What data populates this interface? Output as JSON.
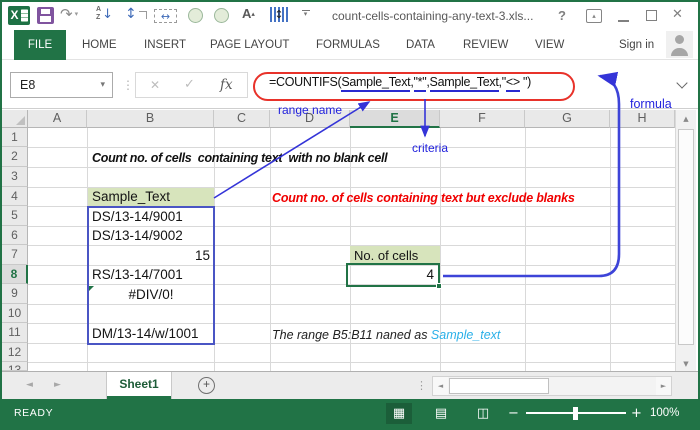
{
  "window": {
    "title": "count-cells-containing-any-text-3.xls...",
    "help": "?"
  },
  "ribbon": {
    "tabs": [
      "FILE",
      "HOME",
      "INSERT",
      "PAGE LAYOUT",
      "FORMULAS",
      "DATA",
      "REVIEW",
      "VIEW"
    ],
    "sign_in": "Sign in"
  },
  "formula_bar": {
    "name_box": "E8",
    "fx": "fx",
    "formula": {
      "p1": "=COUNTIFS(",
      "t1": "Sample_Text",
      "c1": ",",
      "t2": "\"*\"",
      "c2": ",",
      "t3": "Sample_Text",
      "c3": ",\"",
      "t4": "<>",
      "p2": " \")"
    }
  },
  "annotations": {
    "range_name": "range name",
    "criteria": "criteria",
    "formula": "formula"
  },
  "grid": {
    "columns": [
      "A",
      "B",
      "C",
      "D",
      "E",
      "F",
      "G",
      "H"
    ],
    "rows": [
      "1",
      "2",
      "3",
      "4",
      "5",
      "6",
      "7",
      "8",
      "9",
      "10",
      "11",
      "12",
      "13"
    ],
    "cells": {
      "b2": "Count no. of cells  containing text  with no blank cell",
      "b4": "Sample_Text",
      "b5": "DS/13-14/9001",
      "b6": "DS/13-14/9002",
      "b7": "15",
      "b8": "RS/13-14/7001",
      "b9": "#DIV/0!",
      "b11": "DM/13-14/w/1001",
      "d4": "Count no. of cells containing text but exclude blanks",
      "e7": "No. of cells",
      "e8": "4",
      "d11_text": "The range B5:B11 naned as ",
      "d11_name": "Sample_text"
    }
  },
  "sheet_bar": {
    "active_tab": "Sheet1"
  },
  "status_bar": {
    "mode": "READY",
    "zoom_out": "−",
    "zoom_in": "+",
    "zoom_level": "100%"
  },
  "icons": {
    "dropdown": "▾",
    "dots": "⋮",
    "cancel": "✕",
    "enter": "✓",
    "redo": "↷",
    "sort_a": "A",
    "sort_z": "Z",
    "arrow_down": "↓",
    "updown": "↕",
    "leftright": "↔",
    "font_a": "A",
    "caret_up": "▴",
    "close": "✕",
    "excel_x": "X",
    "plus": "+",
    "nav_left": "◄",
    "nav_right": "►",
    "scroll_up": "▲",
    "scroll_down": "▼",
    "scroll_left": "◄",
    "scroll_right": "►",
    "view_normal": "▦",
    "view_layout": "▤",
    "view_break": "◫"
  },
  "colors": {
    "excel_green": "#217346",
    "fill_green": "#d7e4bc",
    "annotation_blue": "#3434d8",
    "range_border_blue": "#4a55c4",
    "oval_red": "#e8322a",
    "text_red": "#f00000",
    "link_cyan": "#2bb0e8"
  }
}
